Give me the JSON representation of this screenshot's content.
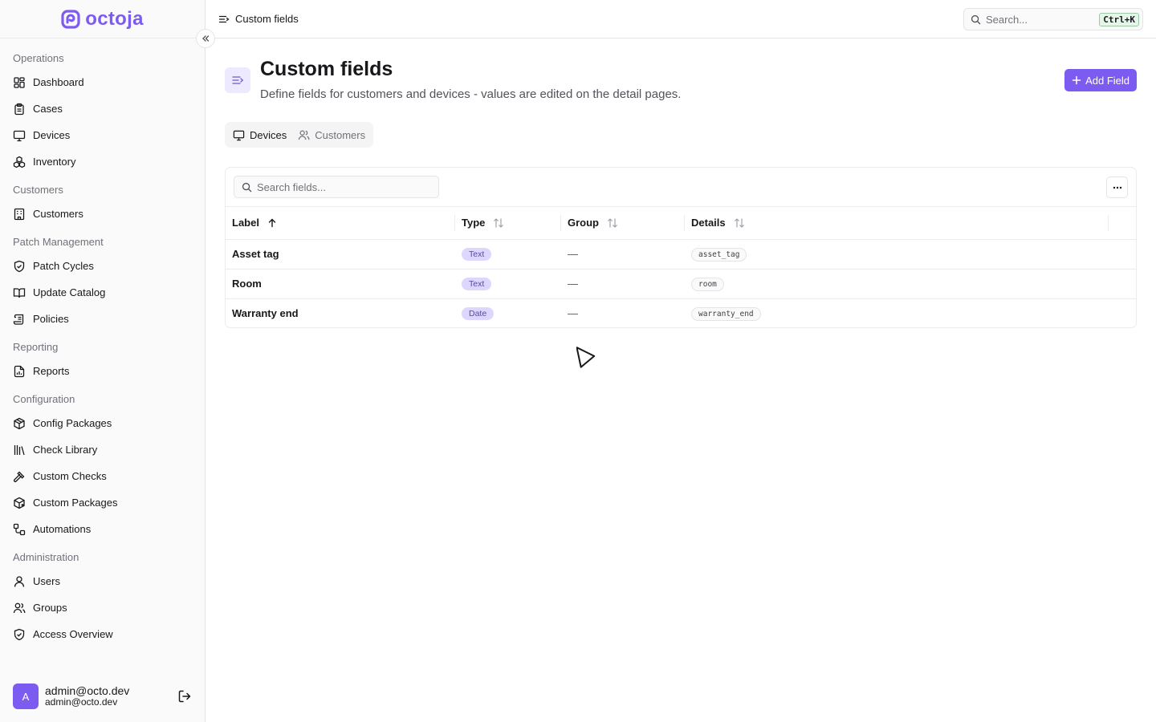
{
  "app": {
    "logo_text": "octoja"
  },
  "sidebar": {
    "groups": [
      {
        "label": "Operations",
        "items": [
          {
            "label": "Dashboard",
            "icon": "dashboard-icon"
          },
          {
            "label": "Cases",
            "icon": "clipboard-icon"
          },
          {
            "label": "Devices",
            "icon": "monitor-icon"
          },
          {
            "label": "Inventory",
            "icon": "boxes-icon"
          }
        ]
      },
      {
        "label": "Customers",
        "items": [
          {
            "label": "Customers",
            "icon": "building-icon"
          }
        ]
      },
      {
        "label": "Patch Management",
        "items": [
          {
            "label": "Patch Cycles",
            "icon": "shield-check-icon"
          },
          {
            "label": "Update Catalog",
            "icon": "book-open-icon"
          },
          {
            "label": "Policies",
            "icon": "scroll-icon"
          }
        ]
      },
      {
        "label": "Reporting",
        "items": [
          {
            "label": "Reports",
            "icon": "file-chart-icon"
          }
        ]
      },
      {
        "label": "Configuration",
        "items": [
          {
            "label": "Config Packages",
            "icon": "package-icon"
          },
          {
            "label": "Check Library",
            "icon": "library-icon"
          },
          {
            "label": "Custom Checks",
            "icon": "hammer-icon"
          },
          {
            "label": "Custom Packages",
            "icon": "package-plus-icon"
          },
          {
            "label": "Automations",
            "icon": "workflow-icon"
          }
        ]
      },
      {
        "label": "Administration",
        "items": [
          {
            "label": "Users",
            "icon": "user-icon"
          },
          {
            "label": "Groups",
            "icon": "users-icon"
          },
          {
            "label": "Access Overview",
            "icon": "shield-icon"
          }
        ]
      }
    ],
    "user": {
      "initial": "A",
      "name": "admin@octo.dev",
      "email": "admin@octo.dev"
    }
  },
  "topbar": {
    "breadcrumb": "Custom fields",
    "search_placeholder": "Search...",
    "shortcut": "Ctrl+K"
  },
  "page": {
    "title": "Custom fields",
    "subtitle": "Define fields for customers and devices - values are edited on the detail pages.",
    "add_button": "Add Field",
    "tabs": [
      {
        "label": "Devices",
        "active": true
      },
      {
        "label": "Customers",
        "active": false
      }
    ],
    "field_search_placeholder": "Search fields...",
    "more_label": "···"
  },
  "table": {
    "columns": [
      "Label",
      "Type",
      "Group",
      "Details"
    ],
    "rows": [
      {
        "label": "Asset tag",
        "type": "Text",
        "group": "—",
        "details": "asset_tag"
      },
      {
        "label": "Room",
        "type": "Text",
        "group": "—",
        "details": "room"
      },
      {
        "label": "Warranty end",
        "type": "Date",
        "group": "—",
        "details": "warranty_end"
      }
    ]
  },
  "colors": {
    "accent": "#7c5cf0",
    "badge_bg": "#ddd6fe",
    "border": "#e4e4e7"
  }
}
